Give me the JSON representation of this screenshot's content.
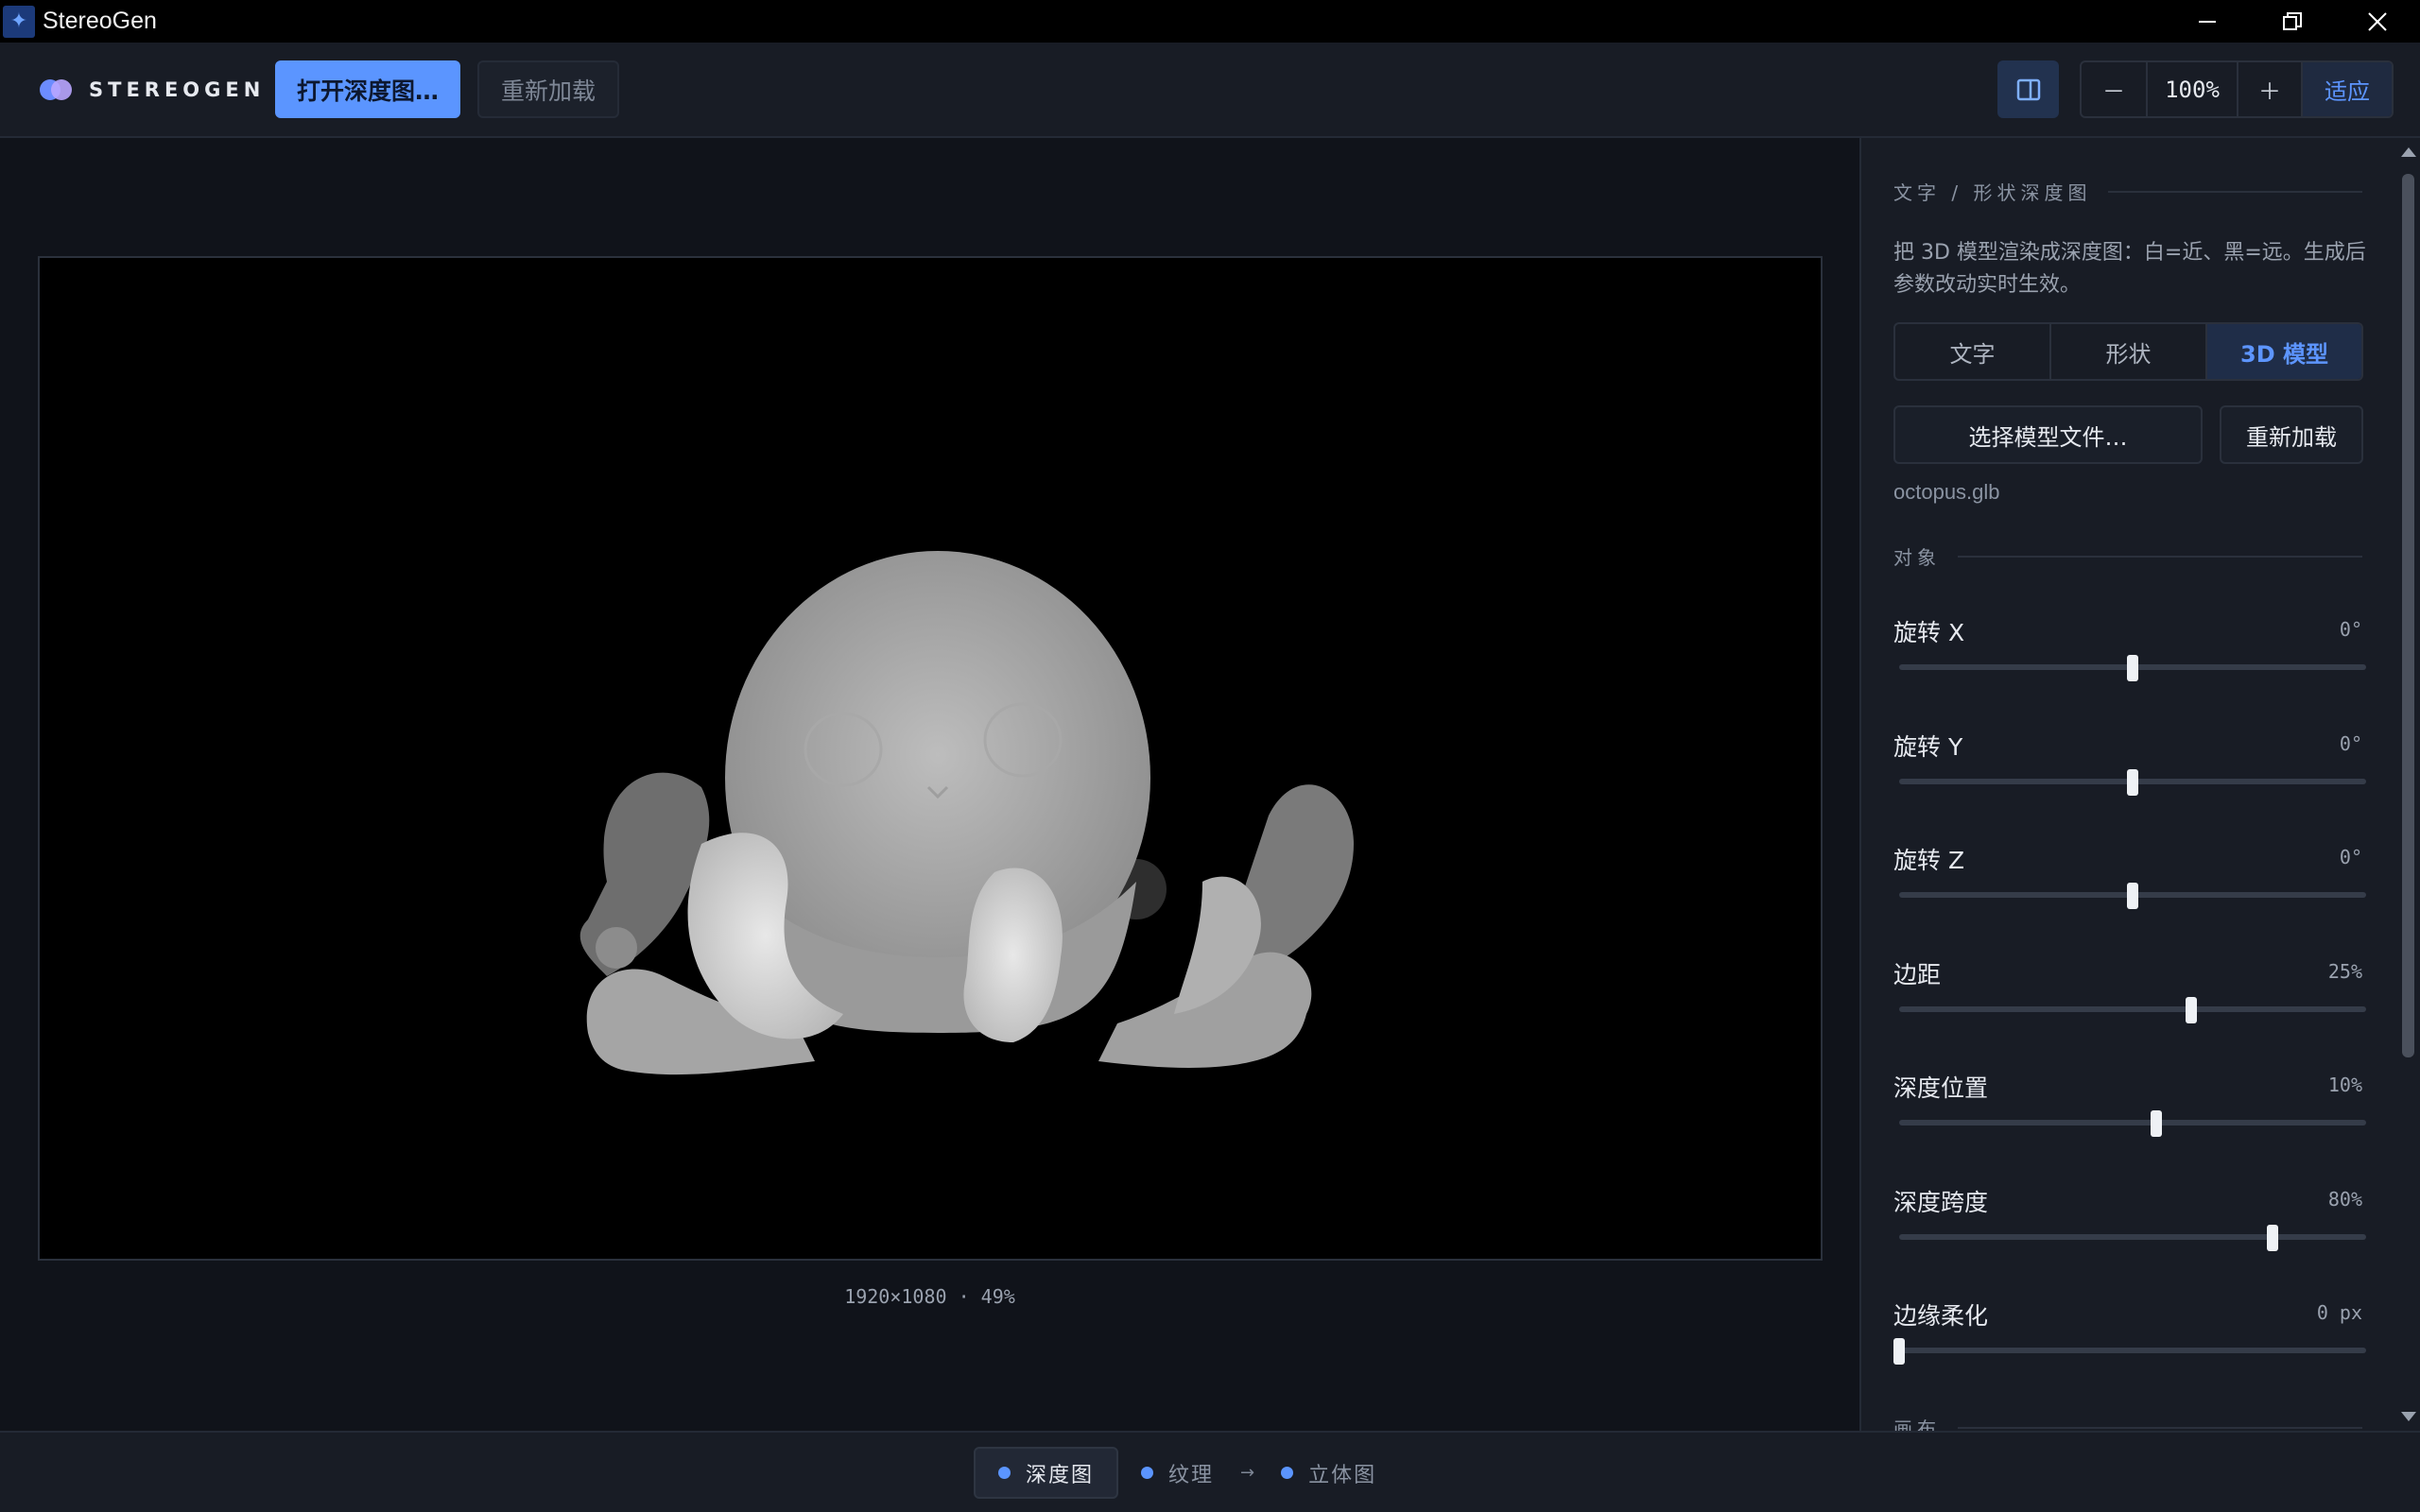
{
  "window": {
    "title": "StereoGen",
    "controls": [
      "minimize",
      "restore",
      "close"
    ]
  },
  "toolbar": {
    "brand": "STEREOGEN",
    "open_label": "打开深度图…",
    "reload_label": "重新加载",
    "zoom": {
      "minus": "－",
      "value": "100%",
      "plus": "＋",
      "fit": "适应"
    }
  },
  "canvas": {
    "dims_label": "1920×1080 · 49%"
  },
  "panel": {
    "section_title": "文字 / 形状深度图",
    "description": "把 3D 模型渲染成深度图：白=近、黑=远。生成后参数改动实时生效。",
    "tabs": [
      {
        "label": "文字",
        "active": false
      },
      {
        "label": "形状",
        "active": false
      },
      {
        "label": "3D 模型",
        "active": true
      }
    ],
    "choose_model": "选择模型文件…",
    "reload_model": "重新加载",
    "filename": "octopus.glb",
    "object_section": "对象",
    "sliders": [
      {
        "label": "旋转 X",
        "value": "0°",
        "position": 0.5
      },
      {
        "label": "旋转 Y",
        "value": "0°",
        "position": 0.5
      },
      {
        "label": "旋转 Z",
        "value": "0°",
        "position": 0.5
      },
      {
        "label": "边距",
        "value": "25%",
        "position": 0.625
      },
      {
        "label": "深度位置",
        "value": "10%",
        "position": 0.55
      },
      {
        "label": "深度跨度",
        "value": "80%",
        "position": 0.8
      },
      {
        "label": "边缘柔化",
        "value": "0 px",
        "position": 0.0
      }
    ],
    "next_section": "画布"
  },
  "pipeline": {
    "steps": [
      {
        "label": "深度图",
        "active": true
      },
      {
        "label": "纹理",
        "active": false
      },
      {
        "label": "立体图",
        "active": false
      }
    ],
    "arrow": "→"
  },
  "colors": {
    "accent": "#5b95ff",
    "background": "#10131a",
    "panel": "#181c25"
  }
}
